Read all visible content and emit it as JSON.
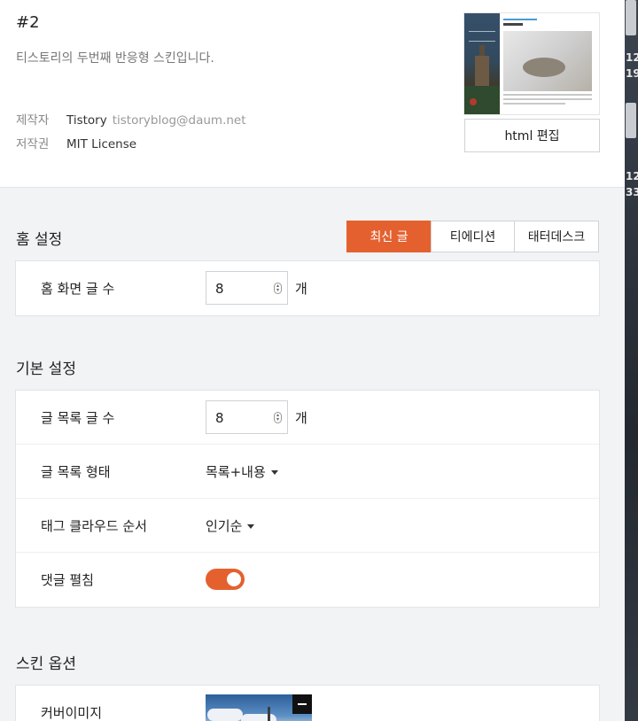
{
  "skin": {
    "name": "#2",
    "description": "티스토리의 두번째 반응형 스킨입니다.",
    "maker_label": "제작자",
    "maker_name": "Tistory",
    "maker_email": "tistoryblog@daum.net",
    "license_label": "저작권",
    "license_value": "MIT License",
    "edit_button": "html 편집"
  },
  "home_settings": {
    "title": "홈 설정",
    "tabs": [
      "최신 글",
      "티에디션",
      "태터데스크"
    ],
    "active_tab": "최신 글",
    "post_count_label": "홈 화면 글 수",
    "post_count_value": "8",
    "unit": "개"
  },
  "basic_settings": {
    "title": "기본 설정",
    "list_count_label": "글 목록 글 수",
    "list_count_value": "8",
    "unit": "개",
    "list_type_label": "글 목록 형태",
    "list_type_value": "목록+내용",
    "tag_order_label": "태그 클라우드 순서",
    "tag_order_value": "인기순",
    "comment_expand_label": "댓글 펼침",
    "comment_expand_on": true
  },
  "skin_options": {
    "title": "스킨 옵션",
    "cover_image_label": "커버이미지"
  },
  "side_strip": {
    "numbers": [
      "12",
      "19",
      "12",
      "33"
    ]
  },
  "colors": {
    "accent": "#e4612f",
    "background": "#f2f3f5"
  }
}
